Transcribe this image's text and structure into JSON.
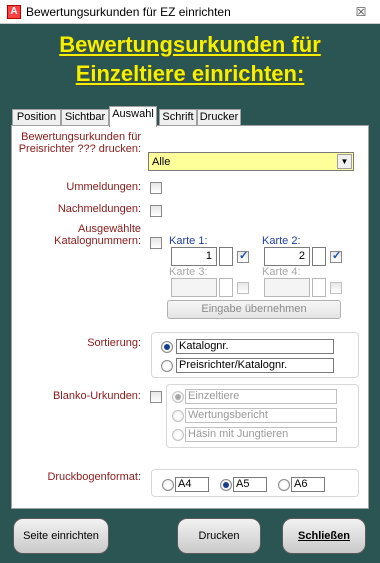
{
  "window": {
    "icon_letter": "A",
    "title": "Bewertungsurkunden für EZ einrichten",
    "close_glyph": "☒"
  },
  "heading": {
    "line1": "Bewertungsurkunden für",
    "line2": "Einzeltiere einrichten:"
  },
  "tabs": [
    {
      "label": "Position"
    },
    {
      "label": "Sichtbar"
    },
    {
      "label": "Auswahl",
      "active": true
    },
    {
      "label": "Schrift"
    },
    {
      "label": "Drucker"
    }
  ],
  "form": {
    "preisrichter_label": "Bewertungsurkunden für Preisrichter ??? drucken:",
    "preisrichter_value": "Alle",
    "ummeldungen_label": "Ummeldungen:",
    "nachmeldungen_label": "Nachmeldungen:",
    "katalog_label": "Ausgewählte Katalognummern:",
    "karte1_label": "Karte 1:",
    "karte1_value": "1",
    "karte2_label": "Karte 2:",
    "karte2_value": "2",
    "karte3_label": "Karte 3:",
    "karte4_label": "Karte 4:",
    "apply_button": "Eingabe übernehmen",
    "sortierung_label": "Sortierung:",
    "sortierung_options": [
      "Katalognr.",
      "Preisrichter/Katalognr."
    ],
    "blanko_label": "Blanko-Urkunden:",
    "blanko_options": [
      "Einzeltiere",
      "Wertungsbericht",
      "Häsin mit Jungtieren"
    ],
    "format_label": "Druckbogenformat:",
    "format_options": [
      "A4",
      "A5",
      "A6"
    ]
  },
  "footer": {
    "setup_button": "Seite einrichten",
    "print_button": "Drucken",
    "close_button": "Schließen"
  },
  "colors": {
    "background": "#2b5553",
    "heading": "#f3f000",
    "label": "#8b1a1a",
    "select_bg": "#ffff99"
  }
}
